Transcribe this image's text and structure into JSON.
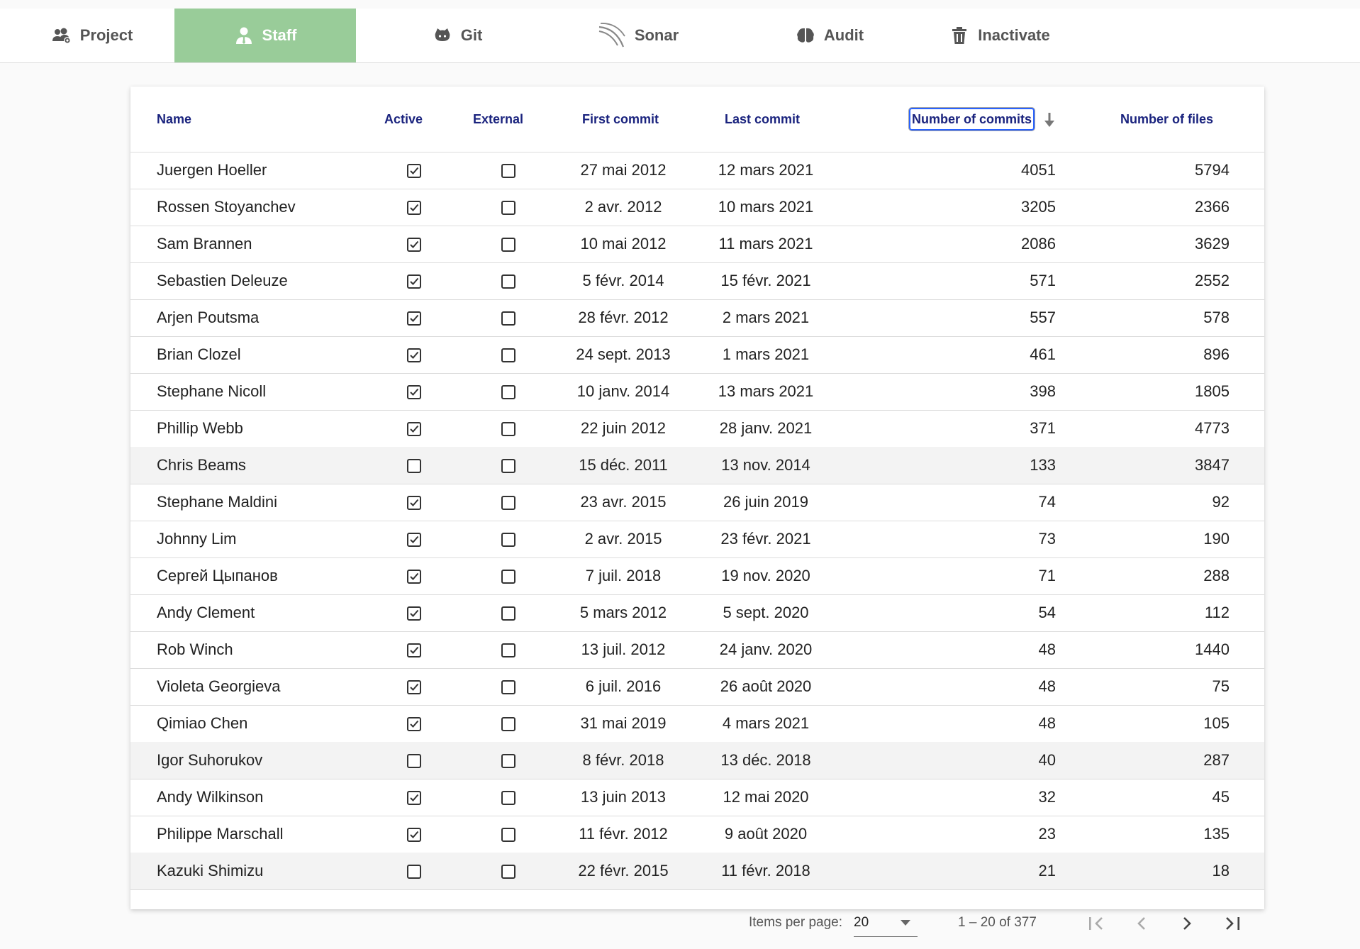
{
  "tabs": [
    {
      "label": "Project",
      "icon": "users-cog-icon"
    },
    {
      "label": "Staff",
      "icon": "user-tie-icon"
    },
    {
      "label": "Git",
      "icon": "github-icon"
    },
    {
      "label": "Sonar",
      "icon": "sonar-icon"
    },
    {
      "label": "Audit",
      "icon": "brain-icon"
    },
    {
      "label": "Inactivate",
      "icon": "trash-icon"
    }
  ],
  "active_tab": "Staff",
  "columns": {
    "name": "Name",
    "active": "Active",
    "external": "External",
    "first_commit": "First commit",
    "last_commit": "Last commit",
    "commits": "Number of commits",
    "files": "Number of files"
  },
  "sort": {
    "column": "Number of commits",
    "direction": "descending"
  },
  "rows": [
    {
      "name": "Juergen Hoeller",
      "active": true,
      "external": false,
      "first": "27 mai 2012",
      "last": "12 mars 2021",
      "commits": "4051",
      "files": "5794"
    },
    {
      "name": "Rossen Stoyanchev",
      "active": true,
      "external": false,
      "first": "2 avr. 2012",
      "last": "10 mars 2021",
      "commits": "3205",
      "files": "2366"
    },
    {
      "name": "Sam Brannen",
      "active": true,
      "external": false,
      "first": "10 mai 2012",
      "last": "11 mars 2021",
      "commits": "2086",
      "files": "3629"
    },
    {
      "name": "Sebastien Deleuze",
      "active": true,
      "external": false,
      "first": "5 févr. 2014",
      "last": "15 févr. 2021",
      "commits": "571",
      "files": "2552"
    },
    {
      "name": "Arjen Poutsma",
      "active": true,
      "external": false,
      "first": "28 févr. 2012",
      "last": "2 mars 2021",
      "commits": "557",
      "files": "578"
    },
    {
      "name": "Brian Clozel",
      "active": true,
      "external": false,
      "first": "24 sept. 2013",
      "last": "1 mars 2021",
      "commits": "461",
      "files": "896"
    },
    {
      "name": "Stephane Nicoll",
      "active": true,
      "external": false,
      "first": "10 janv. 2014",
      "last": "13 mars 2021",
      "commits": "398",
      "files": "1805"
    },
    {
      "name": "Phillip Webb",
      "active": true,
      "external": false,
      "first": "22 juin 2012",
      "last": "28 janv. 2021",
      "commits": "371",
      "files": "4773"
    },
    {
      "name": "Chris Beams",
      "active": false,
      "external": false,
      "first": "15 déc. 2011",
      "last": "13 nov. 2014",
      "commits": "133",
      "files": "3847"
    },
    {
      "name": "Stephane Maldini",
      "active": true,
      "external": false,
      "first": "23 avr. 2015",
      "last": "26 juin 2019",
      "commits": "74",
      "files": "92"
    },
    {
      "name": "Johnny Lim",
      "active": true,
      "external": false,
      "first": "2 avr. 2015",
      "last": "23 févr. 2021",
      "commits": "73",
      "files": "190"
    },
    {
      "name": "Сергей Цыпанов",
      "active": true,
      "external": false,
      "first": "7 juil. 2018",
      "last": "19 nov. 2020",
      "commits": "71",
      "files": "288"
    },
    {
      "name": "Andy Clement",
      "active": true,
      "external": false,
      "first": "5 mars 2012",
      "last": "5 sept. 2020",
      "commits": "54",
      "files": "112"
    },
    {
      "name": "Rob Winch",
      "active": true,
      "external": false,
      "first": "13 juil. 2012",
      "last": "24 janv. 2020",
      "commits": "48",
      "files": "1440"
    },
    {
      "name": "Violeta Georgieva",
      "active": true,
      "external": false,
      "first": "6 juil. 2016",
      "last": "26 août 2020",
      "commits": "48",
      "files": "75"
    },
    {
      "name": "Qimiao Chen",
      "active": true,
      "external": false,
      "first": "31 mai 2019",
      "last": "4 mars 2021",
      "commits": "48",
      "files": "105"
    },
    {
      "name": "Igor Suhorukov",
      "active": false,
      "external": false,
      "first": "8 févr. 2018",
      "last": "13 déc. 2018",
      "commits": "40",
      "files": "287"
    },
    {
      "name": "Andy Wilkinson",
      "active": true,
      "external": false,
      "first": "13 juin 2013",
      "last": "12 mai 2020",
      "commits": "32",
      "files": "45"
    },
    {
      "name": "Philippe Marschall",
      "active": true,
      "external": false,
      "first": "11 févr. 2012",
      "last": "9 août 2020",
      "commits": "23",
      "files": "135"
    },
    {
      "name": "Kazuki Shimizu",
      "active": false,
      "external": false,
      "first": "22 févr. 2015",
      "last": "11 févr. 2018",
      "commits": "21",
      "files": "18"
    }
  ],
  "paginator": {
    "items_per_page_label": "Items per page:",
    "page_size": "20",
    "range_label": "1 – 20 of 377"
  },
  "colors": {
    "active_tab": "#99cc99",
    "header_text": "#1a237e",
    "sort_focus": "#2962ff"
  }
}
